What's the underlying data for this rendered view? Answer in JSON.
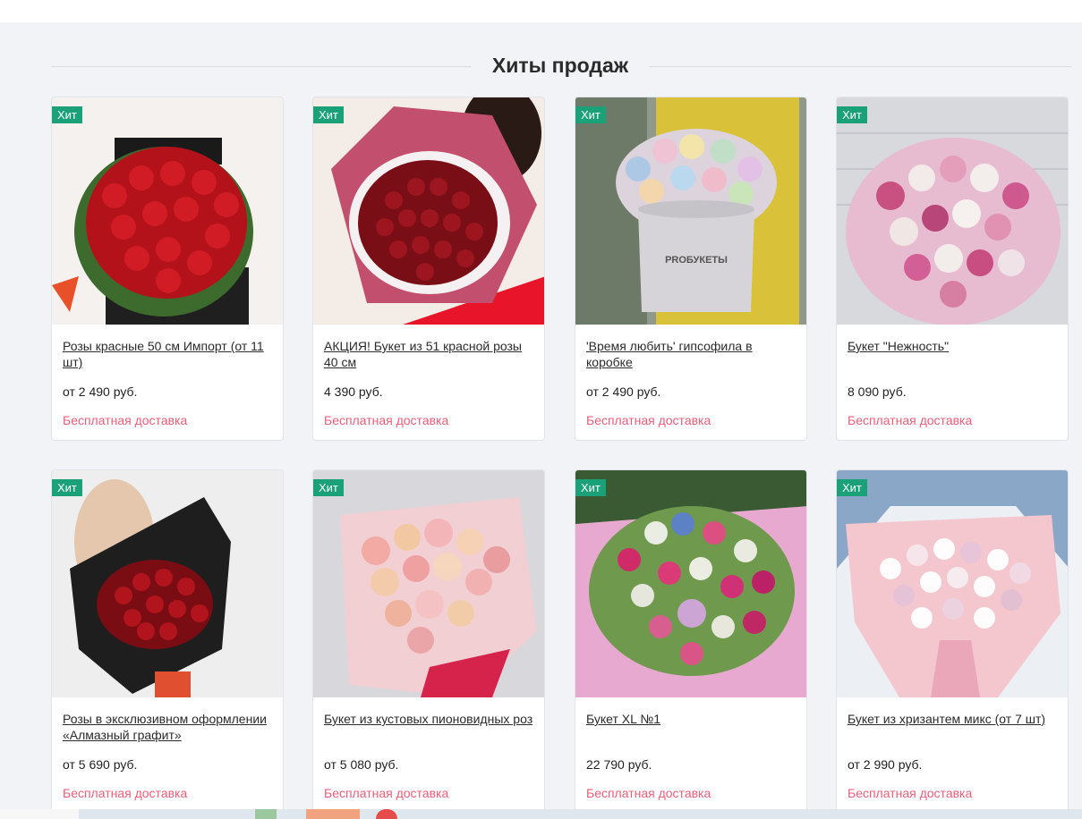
{
  "section": {
    "title": "Хиты продаж"
  },
  "products": [
    {
      "badge": "Хит",
      "title": "Розы красные 50 см Импорт (от 11 шт)",
      "price": "от 2 490 руб.",
      "delivery": "Бесплатная доставка"
    },
    {
      "badge": "Хит",
      "title": "АКЦИЯ! Букет из 51 красной розы 40 см",
      "price": "4 390 руб.",
      "delivery": "Бесплатная доставка"
    },
    {
      "badge": "Хит",
      "title": "'Время любить' гипсофила в коробке",
      "price": "от 2 490 руб.",
      "delivery": "Бесплатная доставка"
    },
    {
      "badge": "Хит",
      "title": "Букет \"Нежность\"",
      "price": "8 090 руб.",
      "delivery": "Бесплатная доставка"
    },
    {
      "badge": "Хит",
      "title": "Розы в эксклюзивном оформлении «Алмазный графит»",
      "price": "от 5 690 руб.",
      "delivery": "Бесплатная доставка"
    },
    {
      "badge": "Хит",
      "title": "Букет из кустовых пионовидных роз",
      "price": "от 5 080 руб.",
      "delivery": "Бесплатная доставка"
    },
    {
      "badge": "Хит",
      "title": "Букет XL №1",
      "price": "22 790 руб.",
      "delivery": "Бесплатная доставка"
    },
    {
      "badge": "Хит",
      "title": "Букет из хризантем микс (от 7 шт)",
      "price": "от 2 990 руб.",
      "delivery": "Бесплатная доставка"
    }
  ],
  "colors": {
    "badge": "#1aa178",
    "delivery": "#e8607a",
    "background": "#f1f3f6"
  }
}
